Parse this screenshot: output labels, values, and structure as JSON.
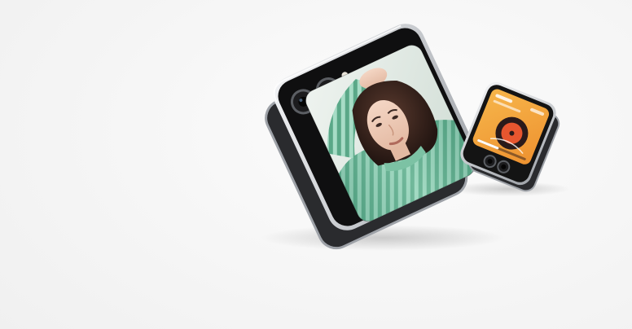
{
  "scene": {
    "background_color": "#f4f4f4",
    "devices": [
      {
        "name": "large-flip-phone",
        "frame_color": "#c9ccd0",
        "body_color": "#0f0f10",
        "cover_screen": {
          "content": "portrait-photo",
          "palette": [
            "#dfe9e2",
            "#4e9b7d",
            "#8fd0b4",
            "#3b2822",
            "#f1d3c0"
          ]
        },
        "cameras": 2
      },
      {
        "name": "small-flip-phone",
        "frame_color": "#b8bcc2",
        "body_color": "#141414",
        "cover_screen": {
          "content": "music-widget",
          "palette": [
            "#f2a73c",
            "#e7562f",
            "#2a1a1a",
            "#ffffff"
          ]
        },
        "cameras": 2
      }
    ]
  }
}
